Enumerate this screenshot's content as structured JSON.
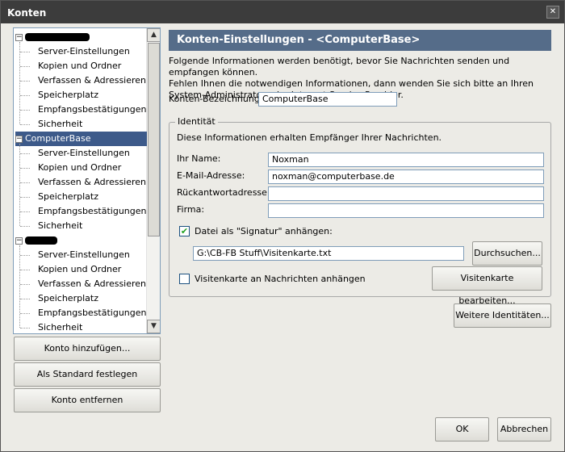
{
  "window": {
    "title": "Konten",
    "close_glyph": "✕"
  },
  "tree": {
    "accounts": [
      {
        "name": "",
        "redacted": true,
        "expander": "−",
        "selected": false,
        "children": [
          "Server-Einstellungen",
          "Kopien und Ordner",
          "Verfassen & Adressieren",
          "Speicherplatz",
          "Empfangsbestätigungen",
          "Sicherheit"
        ]
      },
      {
        "name": "ComputerBase",
        "redacted": false,
        "expander": "−",
        "selected": true,
        "children": [
          "Server-Einstellungen",
          "Kopien und Ordner",
          "Verfassen & Adressieren",
          "Speicherplatz",
          "Empfangsbestätigungen",
          "Sicherheit"
        ]
      },
      {
        "name": "",
        "redacted": true,
        "expander": "−",
        "selected": false,
        "children": [
          "Server-Einstellungen",
          "Kopien und Ordner",
          "Verfassen & Adressieren",
          "Speicherplatz",
          "Empfangsbestätigungen",
          "Sicherheit"
        ]
      }
    ],
    "scroll_up_glyph": "▲",
    "scroll_down_glyph": "▼"
  },
  "side_buttons": {
    "add_account": "Konto hinzufügen...",
    "set_default": "Als Standard festlegen",
    "remove_account": "Konto entfernen"
  },
  "settings": {
    "header": "Konten-Einstellungen - <ComputerBase>",
    "info_line1": "Folgende Informationen werden benötigt, bevor Sie Nachrichten senden und empfangen können.",
    "info_line2": "Fehlen Ihnen die notwendigen Informationen, dann wenden Sie sich bitte an Ihren",
    "info_line3": "System-Administrator oder Internet Service Provider.",
    "account_name_label": "Konten-Bezeichnung:",
    "account_name_value": "ComputerBase",
    "identity": {
      "legend": "Identität",
      "intro": "Diese Informationen erhalten Empfänger Ihrer Nachrichten.",
      "name_label": "Ihr Name:",
      "name_value": "Noxman",
      "email_label": "E-Mail-Adresse:",
      "email_value": "noxman@computerbase.de",
      "reply_label": "Rückantwortadresse:",
      "reply_value": "",
      "company_label": "Firma:",
      "company_value": "",
      "signature_checkbox_label": "Datei als \"Signatur\" anhängen:",
      "signature_checked": true,
      "signature_path": "G:\\CB-FB Stuff\\Visitenkarte.txt",
      "browse_button": "Durchsuchen...",
      "vcard_checkbox_label": "Visitenkarte an Nachrichten anhängen",
      "vcard_checked": false,
      "edit_vcard_button": "Visitenkarte bearbeiten...",
      "check_glyph": "✔"
    },
    "more_identities_button": "Weitere Identitäten..."
  },
  "footer": {
    "ok": "OK",
    "cancel": "Abbrechen"
  }
}
